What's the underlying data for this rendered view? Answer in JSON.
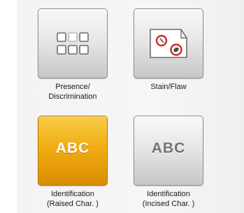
{
  "tiles": [
    {
      "label": [
        "Presence/",
        "Discrimination"
      ],
      "icon": "grid-squares-icon",
      "selected": false
    },
    {
      "label": [
        "Stain/Flaw"
      ],
      "icon": "stain-flaw-icon",
      "selected": false
    },
    {
      "label": [
        "Identification",
        "(Raised Char. )"
      ],
      "icon_text": "ABC",
      "selected": true
    },
    {
      "label": [
        "Identification",
        "(Incised Char. )"
      ],
      "icon_text": "ABC",
      "selected": false
    }
  ],
  "colors": {
    "selected_accent": "#f2ad12",
    "stain_red": "#d3242c"
  }
}
